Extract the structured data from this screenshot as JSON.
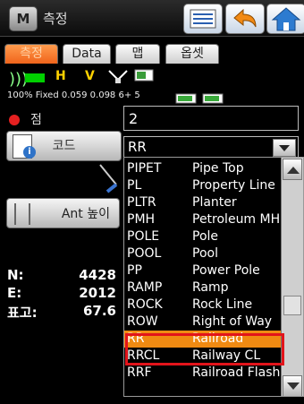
{
  "window": {
    "app_icon_letter": "M",
    "title": "측정"
  },
  "tabs": [
    {
      "label": "측정",
      "active": true
    },
    {
      "label": "Data",
      "active": false
    },
    {
      "label": "맵",
      "active": false
    },
    {
      "label": "옵셋",
      "active": false
    }
  ],
  "status": {
    "letters": [
      "H",
      "V"
    ],
    "text": "100% Fixed 0.059 0.098  6+ 5"
  },
  "point": {
    "label": "점",
    "value": "2"
  },
  "code": {
    "button_label": "코드",
    "selected": "RR"
  },
  "antenna": {
    "button_label": "Ant 높이"
  },
  "coords": [
    {
      "label": "N:",
      "value": "4428"
    },
    {
      "label": "E:",
      "value": "2012"
    },
    {
      "label": "표고:",
      "value": "67.6"
    }
  ],
  "dropdown": [
    {
      "code": "PIPET",
      "desc": "Pipe Top"
    },
    {
      "code": "PL",
      "desc": "Property Line"
    },
    {
      "code": "PLTR",
      "desc": "Planter"
    },
    {
      "code": "PMH",
      "desc": "Petroleum MH"
    },
    {
      "code": "POLE",
      "desc": "Pole"
    },
    {
      "code": "POOL",
      "desc": "Pool"
    },
    {
      "code": "PP",
      "desc": "Power Pole"
    },
    {
      "code": "RAMP",
      "desc": "Ramp"
    },
    {
      "code": "ROCK",
      "desc": "Rock Line"
    },
    {
      "code": "ROW",
      "desc": "Right of Way"
    },
    {
      "code": "RR",
      "desc": "Railroad"
    },
    {
      "code": "RRCL",
      "desc": "Railway CL"
    },
    {
      "code": "RRF",
      "desc": "Railroad Flash"
    }
  ],
  "colors": {
    "accent": "#f08a12",
    "highlight_border": "#e2141b",
    "tab_active": "#f0641b"
  }
}
